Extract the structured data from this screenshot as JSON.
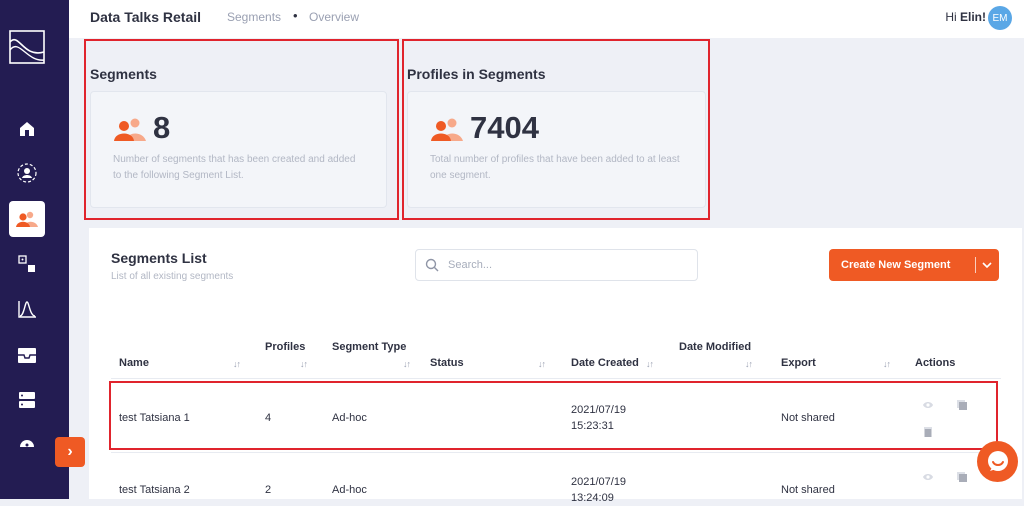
{
  "app": {
    "title": "Data Talks Retail"
  },
  "breadcrumb": {
    "items": [
      "Segments",
      "Overview"
    ],
    "separator": "•"
  },
  "user": {
    "greeting": "Hi",
    "name": "Elin!",
    "initials": "EM"
  },
  "sidebar": {
    "logo": "chart-logo-icon",
    "items": [
      {
        "name": "home-icon",
        "active": false
      },
      {
        "name": "profile-network-icon",
        "active": false
      },
      {
        "name": "segments-icon",
        "active": true
      },
      {
        "name": "dice-icon",
        "active": false
      },
      {
        "name": "distribution-chart-icon",
        "active": false
      },
      {
        "name": "inbox-icon",
        "active": false
      },
      {
        "name": "server-icon",
        "active": false
      },
      {
        "name": "dashboard-gauge-icon",
        "active": false
      }
    ],
    "expand_icon": "›"
  },
  "stats": {
    "segments": {
      "title": "Segments",
      "value": "8",
      "description": "Number of segments that has been created and added to the following Segment List."
    },
    "profiles": {
      "title": "Profiles in Segments",
      "value": "7404",
      "description": "Total number of profiles that have been added to at least one segment."
    }
  },
  "segments_list": {
    "title": "Segments List",
    "subtitle": "List of all existing segments",
    "search": {
      "placeholder": "Search..."
    },
    "create_button": "Create New Segment",
    "columns": {
      "name": "Name",
      "profiles": "Profiles",
      "segment_type": "Segment Type",
      "status": "Status",
      "date_created": "Date Created",
      "date_modified": "Date Modified",
      "export": "Export",
      "actions": "Actions"
    },
    "sort_glyph": "↓↑",
    "rows": [
      {
        "name": "test Tatsiana 1",
        "profiles": "4",
        "segment_type": "Ad-hoc",
        "status": "",
        "date_created": "2021/07/19",
        "time_created": "15:23:31",
        "date_modified": "",
        "export": "Not shared"
      },
      {
        "name": "test Tatsiana 2",
        "profiles": "2",
        "segment_type": "Ad-hoc",
        "status": "",
        "date_created": "2021/07/19",
        "time_created": "13:24:09",
        "date_modified": "",
        "export": "Not shared"
      }
    ]
  },
  "colors": {
    "accent": "#ef5a24",
    "sidebar": "#231c52",
    "highlight": "#e0242d"
  }
}
